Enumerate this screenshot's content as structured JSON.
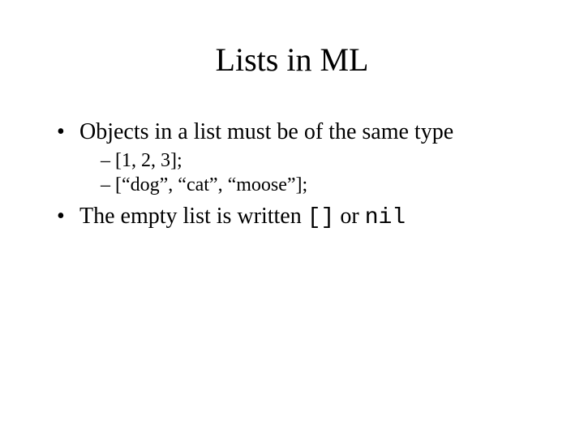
{
  "title": "Lists in ML",
  "bullets": {
    "b1": "Objects in a list must be of the same type",
    "b1_sub1": "[1, 2, 3];",
    "b1_sub2": "[“dog”, “cat”, “moose”];",
    "b2_prefix": "The empty list is written ",
    "b2_code1": "[]",
    "b2_mid": " or ",
    "b2_code2": "nil"
  }
}
